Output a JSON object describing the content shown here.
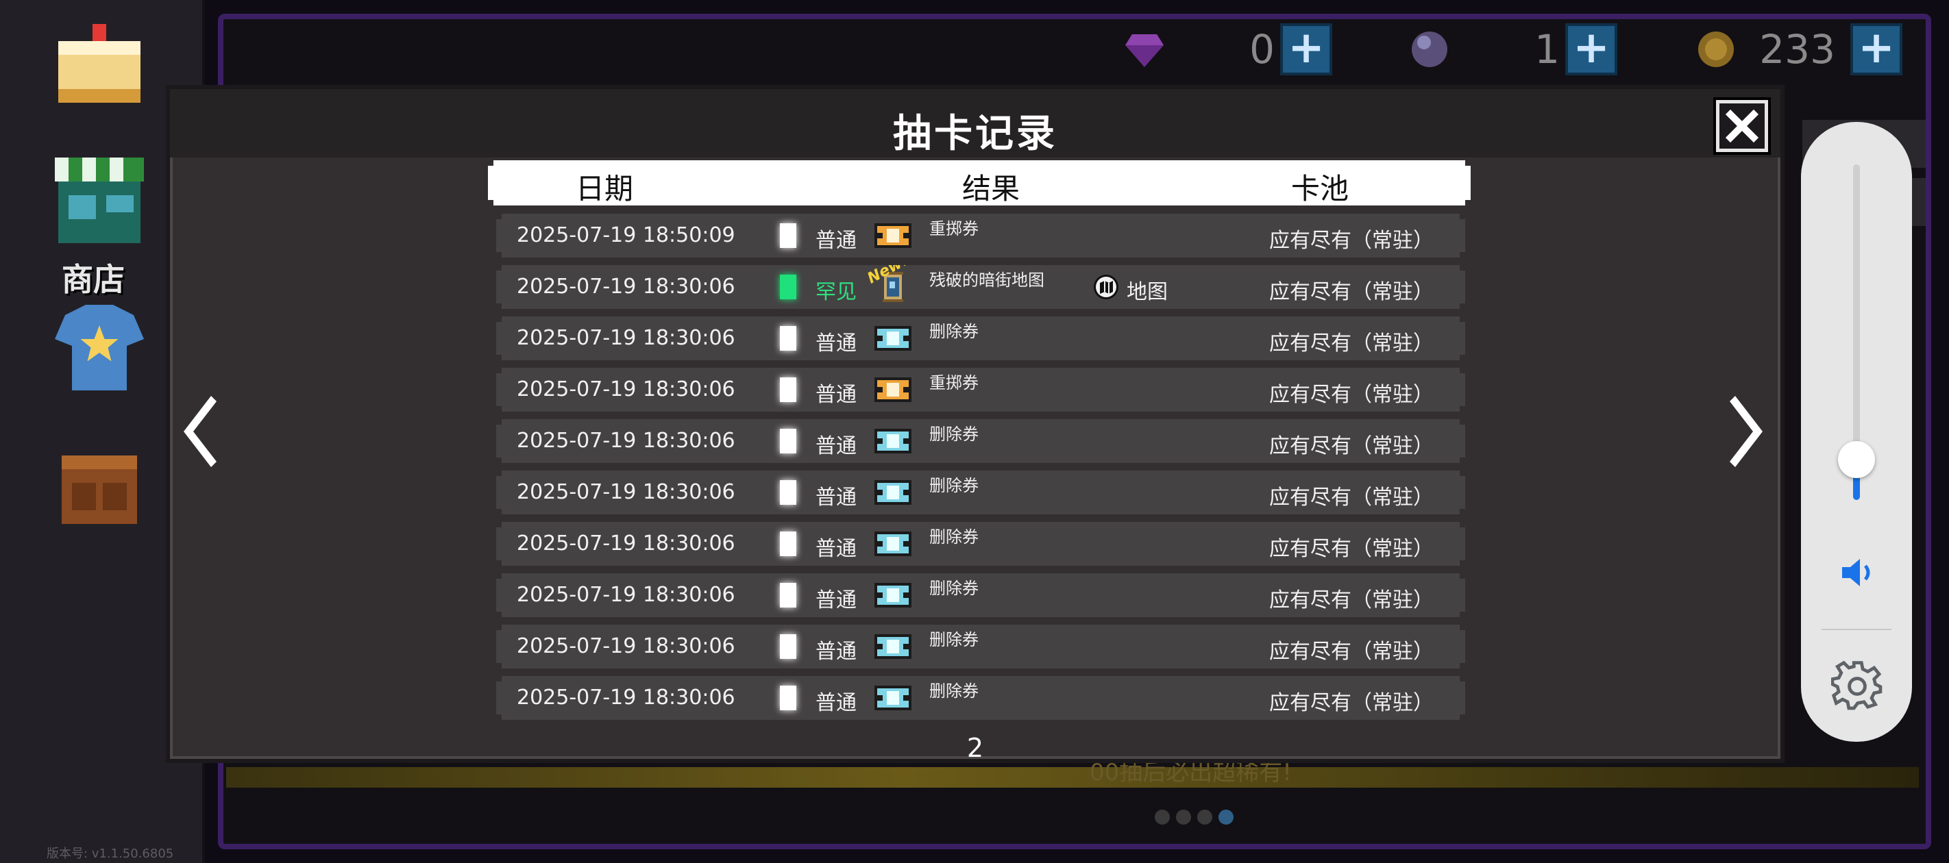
{
  "background": {
    "shop_label": "商店",
    "version": "版本号: v1.1.50.6805",
    "tagline": "00抽后必出超稀有!",
    "currencies": [
      {
        "icon": "gem-icon",
        "value": "0"
      },
      {
        "icon": "orb-icon",
        "value": "1"
      },
      {
        "icon": "coin-icon",
        "value": "233"
      }
    ],
    "plus_label": "+",
    "page_dots": {
      "count": 4,
      "active": 4
    }
  },
  "modal": {
    "title": "抽卡记录",
    "columns": {
      "date": "日期",
      "result": "结果",
      "pool": "卡池"
    },
    "rows": [
      {
        "date": "2025-07-19 18:50:09",
        "rarity": "普通",
        "icon": "reroll-ticket-icon",
        "name": "重掷券",
        "type": "",
        "pool": "应有尽有（常驻）",
        "new": ""
      },
      {
        "date": "2025-07-19 18:30:06",
        "rarity": "罕见",
        "icon": "map-scroll-icon",
        "name": "残破的暗街地图",
        "type": "地图",
        "pool": "应有尽有（常驻）",
        "new": "New!"
      },
      {
        "date": "2025-07-19 18:30:06",
        "rarity": "普通",
        "icon": "delete-ticket-icon",
        "name": "删除券",
        "type": "",
        "pool": "应有尽有（常驻）",
        "new": ""
      },
      {
        "date": "2025-07-19 18:30:06",
        "rarity": "普通",
        "icon": "reroll-ticket-icon",
        "name": "重掷券",
        "type": "",
        "pool": "应有尽有（常驻）",
        "new": ""
      },
      {
        "date": "2025-07-19 18:30:06",
        "rarity": "普通",
        "icon": "delete-ticket-icon",
        "name": "删除券",
        "type": "",
        "pool": "应有尽有（常驻）",
        "new": ""
      },
      {
        "date": "2025-07-19 18:30:06",
        "rarity": "普通",
        "icon": "delete-ticket-icon",
        "name": "删除券",
        "type": "",
        "pool": "应有尽有（常驻）",
        "new": ""
      },
      {
        "date": "2025-07-19 18:30:06",
        "rarity": "普通",
        "icon": "delete-ticket-icon",
        "name": "删除券",
        "type": "",
        "pool": "应有尽有（常驻）",
        "new": ""
      },
      {
        "date": "2025-07-19 18:30:06",
        "rarity": "普通",
        "icon": "delete-ticket-icon",
        "name": "删除券",
        "type": "",
        "pool": "应有尽有（常驻）",
        "new": ""
      },
      {
        "date": "2025-07-19 18:30:06",
        "rarity": "普通",
        "icon": "delete-ticket-icon",
        "name": "删除券",
        "type": "",
        "pool": "应有尽有（常驻）",
        "new": ""
      },
      {
        "date": "2025-07-19 18:30:06",
        "rarity": "普通",
        "icon": "delete-ticket-icon",
        "name": "删除券",
        "type": "",
        "pool": "应有尽有（常驻）",
        "new": ""
      }
    ],
    "page_number": "2"
  },
  "volume": {
    "level": 0.08,
    "accent": "#1a73e8"
  },
  "colors": {
    "common": "#ffffff",
    "rare": "#2be27f",
    "reroll_ticket": "#f0a53a",
    "delete_ticket": "#7fd4e6"
  }
}
